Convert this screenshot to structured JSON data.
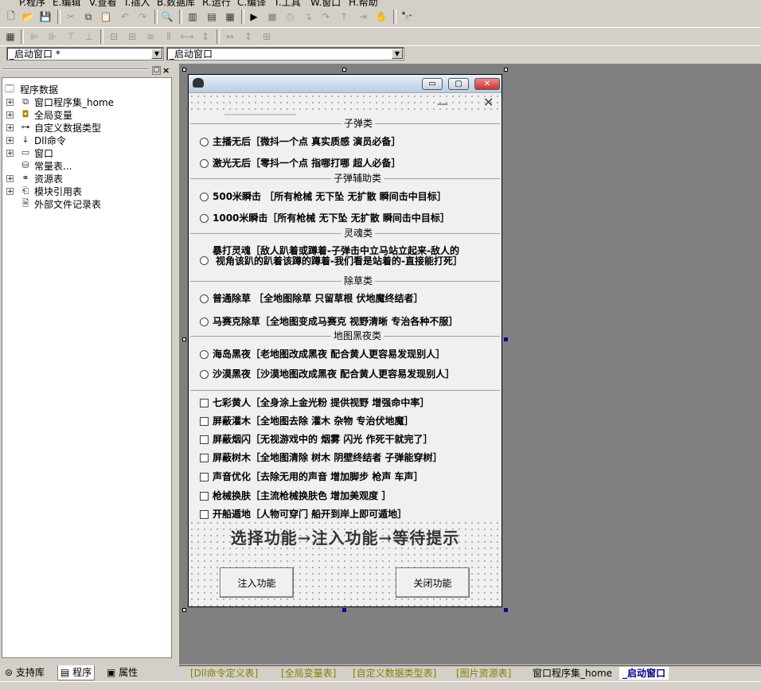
{
  "menu": [
    "P.程序",
    "E.编辑",
    "V.查看",
    "I.插入",
    "B.数据库",
    "R.运行",
    "C.编译",
    "T.工具",
    "W.窗口",
    "H.帮助"
  ],
  "combos": {
    "left": "_启动窗口 *",
    "right": "_启动窗口"
  },
  "tree": {
    "root": "程序数据",
    "items": [
      {
        "label": "窗口程序集_home",
        "icon": "assembly-icon",
        "expand": "+"
      },
      {
        "label": "全局变量",
        "icon": "global-variable-icon",
        "expand": "+"
      },
      {
        "label": "自定义数据类型",
        "icon": "datatype-icon",
        "expand": "+"
      },
      {
        "label": "Dll命令",
        "icon": "dll-icon",
        "expand": "+"
      },
      {
        "label": "窗口",
        "icon": "window-icon",
        "expand": "+"
      },
      {
        "label": "常量表...",
        "icon": "constant-table-icon",
        "expand": ""
      },
      {
        "label": "资源表",
        "icon": "resource-icon",
        "expand": "+"
      },
      {
        "label": "模块引用表",
        "icon": "module-icon",
        "expand": "+"
      },
      {
        "label": "外部文件记录表",
        "icon": "external-file-icon",
        "expand": ""
      }
    ]
  },
  "left_tabs": [
    "支持库",
    "程序",
    "属性"
  ],
  "form": {
    "sections": [
      "子弹类",
      "子弹辅助类",
      "灵魂类",
      "除草类",
      "地图黑夜类"
    ],
    "radios": [
      "主播无后［微抖一个点 真实质感 演员必备］",
      "激光无后［零抖一个点 指哪打哪 超人必备］",
      "500米瞬击 ［所有枪械 无下坠 无扩散 瞬间击中目标］",
      "1000米瞬击［所有枪械 无下坠 无扩散 瞬间击中目标］",
      "暴打灵魂［敌人趴着或蹲着-子弹击中立马站立起来-敌人的",
      "普通除草 ［全地图除草 只留草根 伏地魔终结者］",
      "马赛克除草［全地图变成马赛克 视野清晰 专治各种不服］",
      "海岛黑夜［老地图改成黑夜 配合黄人更容易发现别人］",
      "沙漠黑夜［沙漠地图改成黑夜 配合黄人更容易发现别人］"
    ],
    "soul_line2": "视角该趴的趴着该蹲的蹲着-我们看是站着的-直接能打死］",
    "checks": [
      "七彩黄人［全身涂上金光粉 提供视野 增强命中率］",
      "屏蔽灌木［全地图去除 灌木 杂物 专治伏地魔］",
      "屏蔽烟闪［无视游戏中的 烟雾 闪光 作死干就完了］",
      "屏蔽树木［全地图清除 树木 阴壁终结者 子弹能穿树］",
      "声音优化［去除无用的声音 增加脚步 枪声 车声］",
      "枪械换肤［主流枪械换肤色 增加美观度 ］",
      "开船遁地［人物可穿门 船开到岸上即可遁地］"
    ],
    "instruction": "选择功能→注入功能→等待提示",
    "inject_button": "注入功能",
    "close_button": "关闭功能"
  },
  "bottom_tabs": [
    "[Dll命令定义表]",
    "[全局变量表]",
    "[自定义数据类型表]",
    "[图片资源表]",
    "窗口程序集_home",
    "_启动窗口"
  ],
  "colors": {
    "design_bg": "#808080",
    "form_client": "#f0f0f0",
    "tab_text": "#808000",
    "active_tab": "#000080"
  }
}
